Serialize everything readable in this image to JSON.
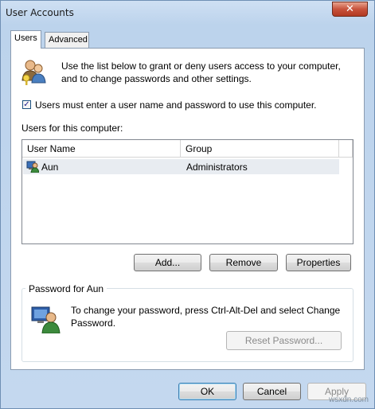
{
  "window": {
    "title": "User Accounts",
    "close_glyph": "✕"
  },
  "tabs": [
    {
      "label": "Users",
      "active": true
    },
    {
      "label": "Advanced",
      "active": false
    }
  ],
  "intro": {
    "line1": "Use the list below to grant or deny users access to your computer,",
    "line2": "and to change passwords and other settings.",
    "icon": "users-key-icon"
  },
  "require_login": {
    "checked": true,
    "label": "Users must enter a user name and password to use this computer."
  },
  "users_section": {
    "label": "Users for this computer:",
    "columns": [
      "User Name",
      "Group"
    ],
    "rows": [
      {
        "name": "Aun",
        "group": "Administrators"
      }
    ]
  },
  "actions": {
    "add": "Add...",
    "remove": "Remove",
    "properties": "Properties"
  },
  "password_group": {
    "title": "Password for Aun",
    "line1": "To change your password, press Ctrl-Alt-Del and select Change",
    "line2": "Password.",
    "reset": "Reset Password..."
  },
  "footer": {
    "ok": "OK",
    "cancel": "Cancel",
    "apply": "Apply"
  },
  "watermark": "wsxdn.com"
}
